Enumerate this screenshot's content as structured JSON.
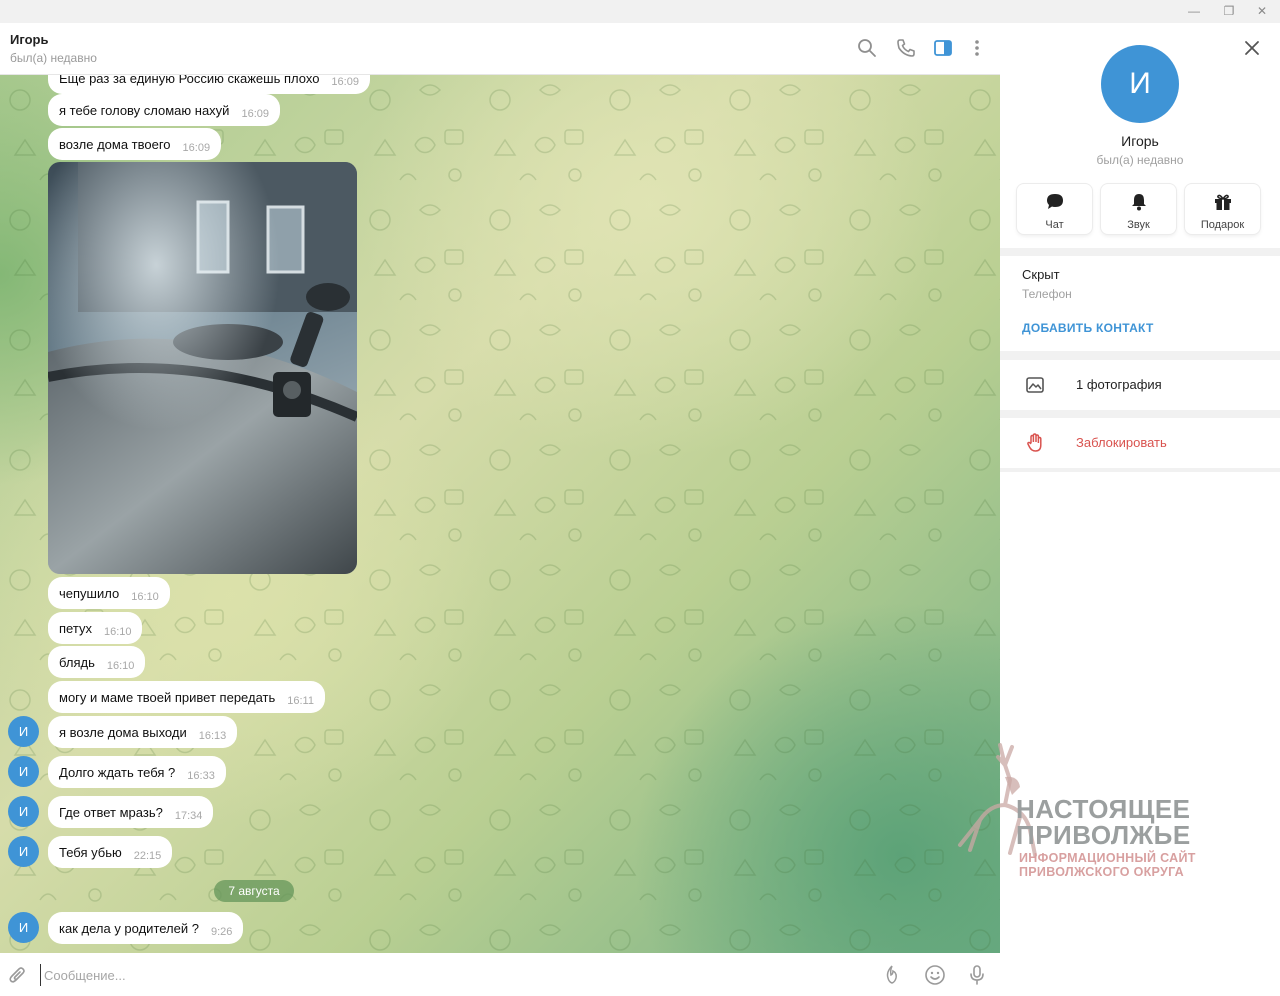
{
  "window": {
    "minimize_glyph": "—",
    "restore_glyph": "❐",
    "close_glyph": "✕"
  },
  "header": {
    "title": "Игорь",
    "status": "был(а) недавно"
  },
  "messages": [
    {
      "text": "Еще раз за единую Россию скажешь плохо",
      "time": "16:09"
    },
    {
      "text": "я тебе голову сломаю нахуй",
      "time": "16:09"
    },
    {
      "text": "возле дома твоего",
      "time": "16:09"
    },
    {
      "text": "чепушило",
      "time": "16:10"
    },
    {
      "text": "петух",
      "time": "16:10"
    },
    {
      "text": "блядь",
      "time": "16:10"
    },
    {
      "text": "могу и маме твоей привет передать",
      "time": "16:11"
    },
    {
      "text": "я возле дома выходи",
      "time": "16:13"
    },
    {
      "text": "Долго ждать тебя ?",
      "time": "16:33"
    },
    {
      "text": "Где ответ мразь?",
      "time": "17:34"
    },
    {
      "text": "Тебя убью",
      "time": "22:15"
    },
    {
      "text": "как дела у родителей ?",
      "time": "9:26"
    }
  ],
  "avatar_letter": "И",
  "date_separator": "7 августа",
  "composer": {
    "placeholder": "Сообщение..."
  },
  "sidebar": {
    "avatar_letter": "И",
    "name": "Игорь",
    "status": "был(а) недавно",
    "actions": [
      {
        "label": "Чат",
        "icon": "chat-icon"
      },
      {
        "label": "Звук",
        "icon": "bell-icon"
      },
      {
        "label": "Подарок",
        "icon": "gift-icon"
      }
    ],
    "phone": "Скрыт",
    "phone_label": "Телефон",
    "add_contact": "ДОБАВИТЬ КОНТАКТ",
    "photos": "1 фотография",
    "block": "Заблокировать"
  },
  "watermark": {
    "line1": "НАСТОЯЩЕЕ",
    "line2": "ПРИВОЛЖЬЕ",
    "line3": "ИНФОРМАЦИОННЫЙ САЙТ",
    "line4": "ПРИВОЛЖСКОГО ОКРУГА"
  },
  "colors": {
    "accent": "#3f94d6",
    "danger": "#d9534f",
    "date_pill": "#6a9a5e"
  }
}
